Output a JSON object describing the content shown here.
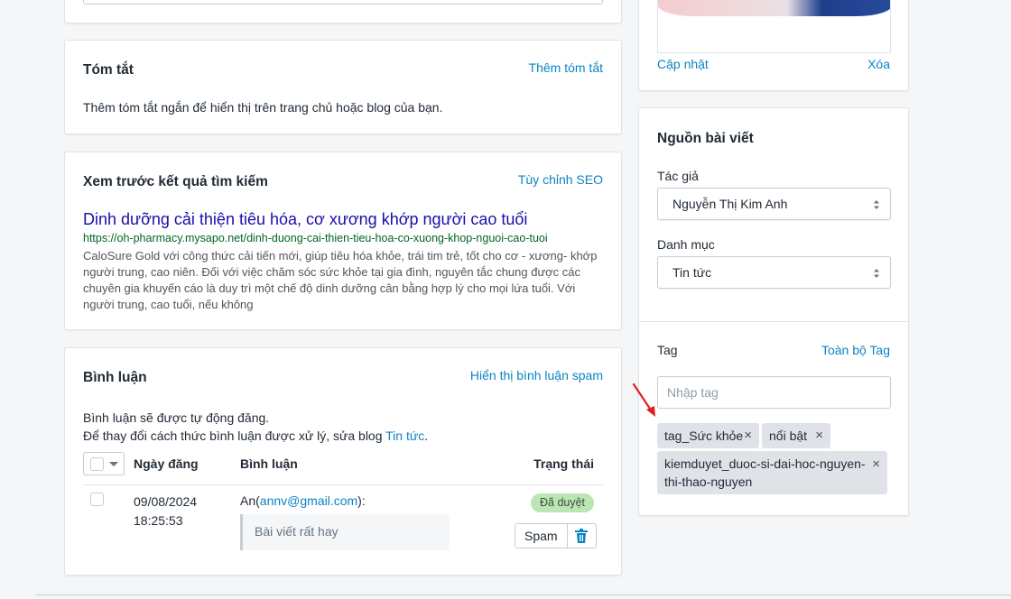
{
  "summary": {
    "title": "Tóm tắt",
    "action": "Thêm tóm tắt",
    "description": "Thêm tóm tắt ngắn để hiển thị trên trang chủ hoặc blog của bạn."
  },
  "seo": {
    "title": "Xem trước kết quả tìm kiếm",
    "action": "Tùy chỉnh SEO",
    "preview_title": "Dinh dưỡng cải thiện tiêu hóa, cơ xương khớp người cao tuổi",
    "preview_url": "https://oh-pharmacy.mysapo.net/dinh-duong-cai-thien-tieu-hoa-co-xuong-khop-nguoi-cao-tuoi",
    "preview_description": "CaloSure Gold với công thức cải tiến mới, giúp tiêu hóa khỏe, trái tim trẻ, tốt cho cơ - xương- khớp người trung, cao niên. Đối với việc chăm sóc sức khỏe tại gia đình, nguyên tắc chung được các chuyên gia khuyến cáo là duy trì một chế độ dinh dưỡng cân bằng hợp lý cho mọi lứa tuổi. Với người trung, cao tuổi, nếu không"
  },
  "comments": {
    "title": "Bình luận",
    "action": "Hiển thị bình luận spam",
    "info_line1": "Bình luận sẽ được tự động đăng.",
    "info_line2_prefix": "Để thay đổi cách thức bình luận được xử lý, sửa blog ",
    "info_line2_link": "Tin tức",
    "info_line2_suffix": ".",
    "columns": {
      "date": "Ngày đăng",
      "comment": "Bình luận",
      "status": "Trạng thái"
    },
    "row": {
      "date": "09/08/2024",
      "time": "18:25:53",
      "author_name": "An",
      "author_email": "annv@gmail.com",
      "author_open": "(",
      "author_close": "):",
      "body": "Bài viết rất hay",
      "status": "Đã duyệt",
      "spam_button": "Spam"
    }
  },
  "image": {
    "update": "Cập nhật",
    "delete": "Xóa"
  },
  "source": {
    "title": "Nguồn bài viết",
    "author_label": "Tác giả",
    "author_value": "Nguyễn Thị Kim Anh",
    "category_label": "Danh mục",
    "category_value": "Tin tức",
    "tag_label": "Tag",
    "tag_all": "Toàn bộ Tag",
    "tag_placeholder": "Nhập tag",
    "tags": [
      "tag_Sức khỏe",
      "nổi bật",
      "kiemduyet_duoc-si-dai-hoc-nguyen-thi-thao-nguyen"
    ],
    "tag_3_line1": "kiemduyet_duoc-si-dai-hoc-nguyen-",
    "tag_3_line2": "thi-thao-nguyen",
    "tag_remove_symbol": "×"
  },
  "colors": {
    "link": "#0a84c2",
    "seo_title": "#1a0dab",
    "seo_url": "#006621",
    "badge_bg": "#bbe5b3",
    "annotation_arrow": "#e02020"
  },
  "icons": [
    "chevron-down-icon",
    "select-arrows-icon",
    "trash-icon",
    "close-icon",
    "arrow-annotation-icon"
  ]
}
